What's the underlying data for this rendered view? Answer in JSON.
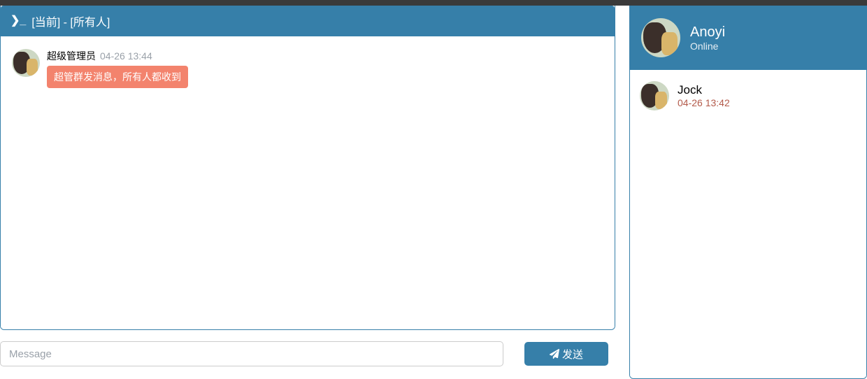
{
  "chat": {
    "header_title": "[当前] - [所有人]",
    "messages": [
      {
        "sender": "超级管理员",
        "time": "04-26 13:44",
        "text": "超管群发消息，所有人都收到"
      }
    ]
  },
  "composer": {
    "placeholder": "Message",
    "send_label": "发送"
  },
  "profile": {
    "name": "Anoyi",
    "status": "Online"
  },
  "contacts": [
    {
      "name": "Jock",
      "time": "04-26 13:42"
    }
  ]
}
